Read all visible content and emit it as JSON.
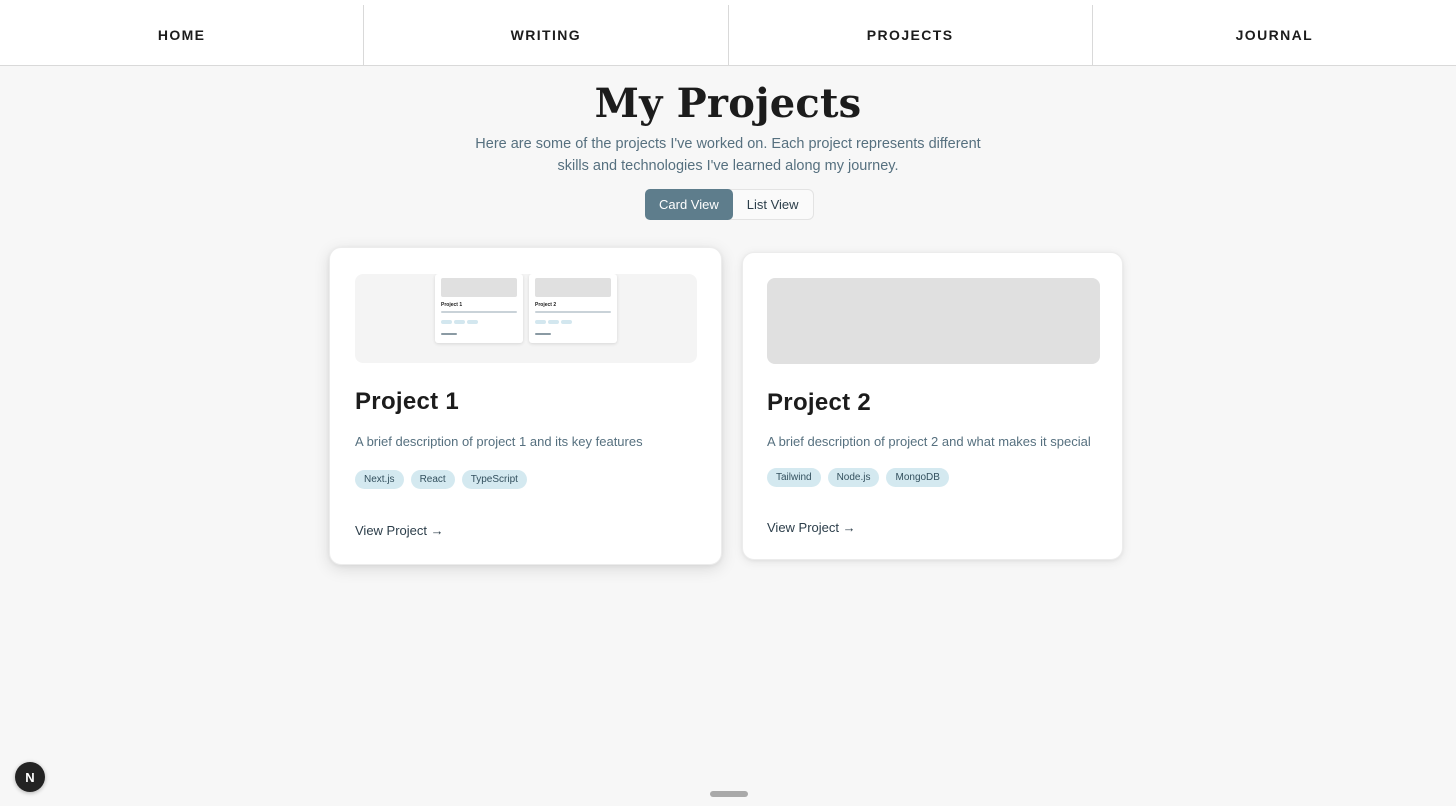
{
  "nav": {
    "items": [
      {
        "label": "HOME"
      },
      {
        "label": "WRITING"
      },
      {
        "label": "PROJECTS"
      },
      {
        "label": "JOURNAL"
      }
    ]
  },
  "header": {
    "title": "My Projects",
    "subtitle": "Here are some of the projects I've worked on. Each project represents different skills and technologies I've learned along my journey."
  },
  "view_toggle": {
    "options": [
      "Card View",
      "List View"
    ],
    "selected": "Card View"
  },
  "projects": [
    {
      "title": "Project 1",
      "description": "A brief description of project 1 and its key features",
      "tags": [
        "Next.js",
        "React",
        "TypeScript"
      ],
      "link_label": "View Project →",
      "thumbnail_preview": {
        "cards": [
          {
            "title": "Project 1"
          },
          {
            "title": "Project 2"
          }
        ]
      }
    },
    {
      "title": "Project 2",
      "description": "A brief description of project 2 and what makes it special",
      "tags": [
        "Tailwind",
        "Node.js",
        "MongoDB"
      ],
      "link_label": "View Project →"
    }
  ],
  "badge": {
    "label": "N"
  },
  "colors": {
    "accent": "#5e7d8c",
    "tag_bg": "#d4e9f0",
    "muted_text": "#56707f",
    "background": "#f7f7f7"
  }
}
